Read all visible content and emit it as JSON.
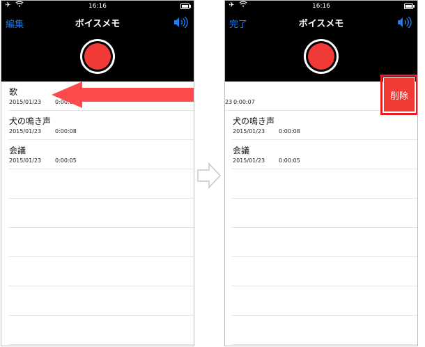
{
  "left_screen": {
    "status": {
      "time": "16:16"
    },
    "nav": {
      "left_button": "編集",
      "title": "ボイスメモ"
    },
    "recordings": [
      {
        "title": "歌",
        "date": "2015/01/23",
        "duration": "0:00:07"
      },
      {
        "title": "犬の鳴き声",
        "date": "2015/01/23",
        "duration": "0:00:08"
      },
      {
        "title": "会議",
        "date": "2015/01/23",
        "duration": "0:00:05"
      }
    ]
  },
  "right_screen": {
    "status": {
      "time": "16:16"
    },
    "nav": {
      "left_button": "完了",
      "title": "ボイスメモ"
    },
    "swiped_row": {
      "date_fragment": "23",
      "duration": "0:00:07"
    },
    "recordings": [
      {
        "title": "犬の鳴き声",
        "date": "2015/01/23",
        "duration": "0:00:08"
      },
      {
        "title": "会議",
        "date": "2015/01/23",
        "duration": "0:00:05"
      }
    ],
    "delete_label": "削除"
  },
  "colors": {
    "accent_blue": "#1e7cf0",
    "record_red": "#f03a38",
    "delete_red": "#f33b36",
    "highlight_red": "#ee1b22",
    "swipe_arrow_red": "#ff4a4d"
  },
  "icons": [
    "airplane-icon",
    "wifi-icon",
    "battery-icon",
    "speaker-icon",
    "record-icon",
    "swipe-left-arrow-icon",
    "right-arrow-icon"
  ]
}
